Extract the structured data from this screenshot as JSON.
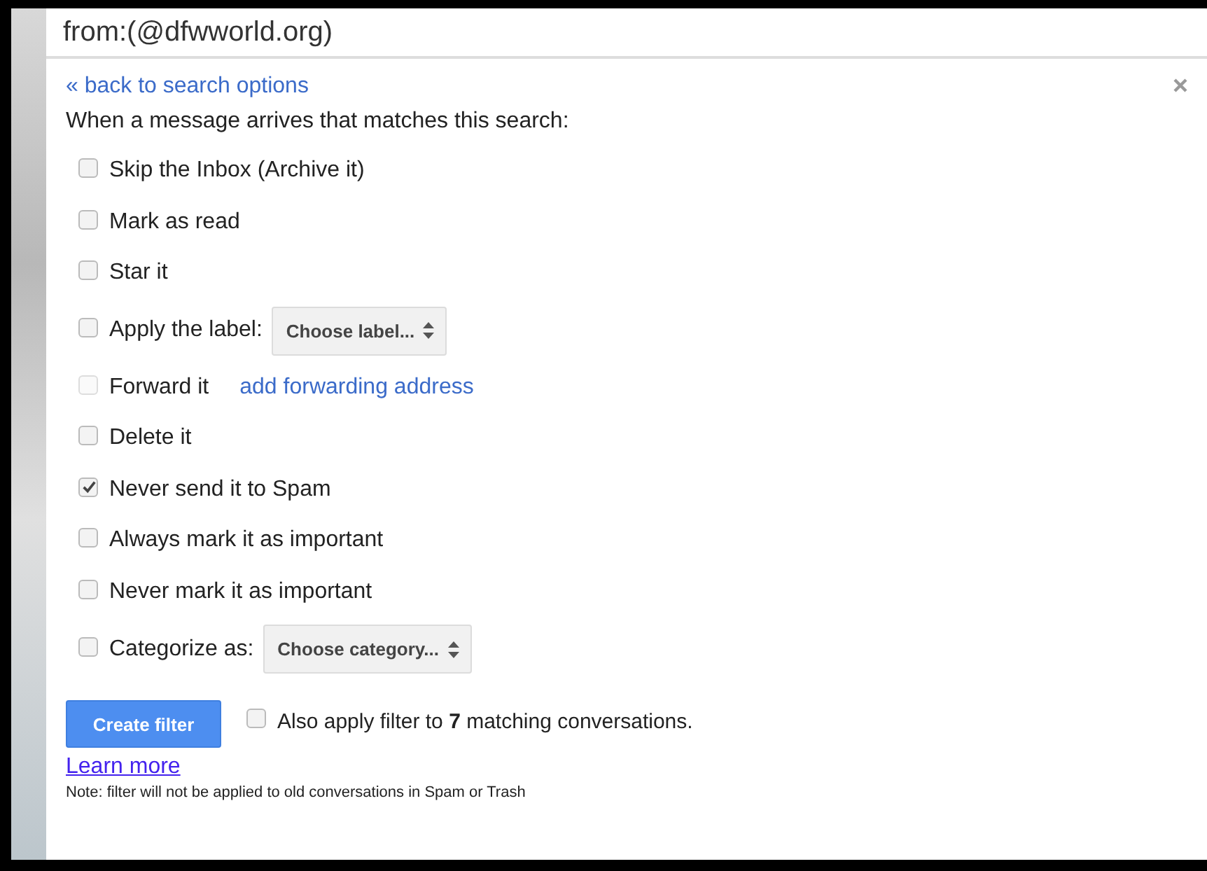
{
  "search": {
    "value": "from:(@dfwworld.org)"
  },
  "back_link": "« back to search options",
  "heading": "When a message arrives that matches this search:",
  "options": [
    {
      "kind": "checkbox",
      "label": "Skip the Inbox (Archive it)",
      "checked": false,
      "disabled": false
    },
    {
      "kind": "checkbox",
      "label": "Mark as read",
      "checked": false,
      "disabled": false
    },
    {
      "kind": "checkbox",
      "label": "Star it",
      "checked": false,
      "disabled": false
    },
    {
      "kind": "select",
      "label": "Apply the label:",
      "checked": false,
      "disabled": false,
      "select": "Choose label..."
    },
    {
      "kind": "link",
      "label": "Forward it",
      "checked": false,
      "disabled": true,
      "link": "add forwarding address"
    },
    {
      "kind": "checkbox",
      "label": "Delete it",
      "checked": false,
      "disabled": false
    },
    {
      "kind": "checkbox",
      "label": "Never send it to Spam",
      "checked": true,
      "disabled": false
    },
    {
      "kind": "checkbox",
      "label": "Always mark it as important",
      "checked": false,
      "disabled": false
    },
    {
      "kind": "checkbox",
      "label": "Never mark it as important",
      "checked": false,
      "disabled": false
    },
    {
      "kind": "select",
      "label": "Categorize as:",
      "checked": false,
      "disabled": false,
      "select": "Choose category..."
    }
  ],
  "create_button": "Create filter",
  "also_apply": {
    "checked": false,
    "text": "Also apply filter to **7** matching conversations."
  },
  "learn_more": "Learn more",
  "note": "Note: filter will not be applied to old conversations in Spam or Trash"
}
